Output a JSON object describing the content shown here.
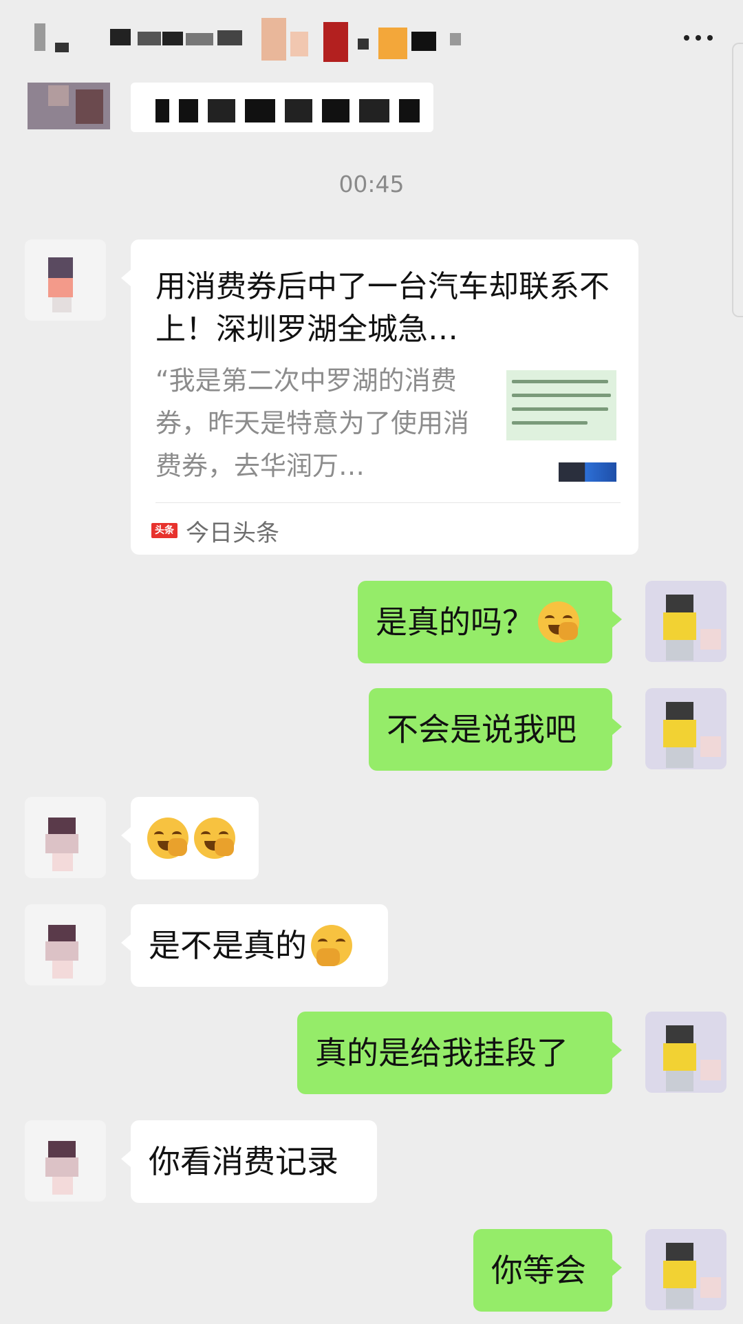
{
  "header": {
    "more_label": "•••"
  },
  "timestamp": "00:45",
  "link_card": {
    "title": "用消费券后中了一台汽车却联系不上！深圳罗湖全城急…",
    "description": "“我是第二次中罗湖的消费券，昨天是特意为了使用消费券，去华润万…",
    "source_logo": "头条",
    "source_name": "今日头条"
  },
  "messages": [
    {
      "side": "out",
      "text": "是真的吗？",
      "emoji": "rolling-laughing"
    },
    {
      "side": "out",
      "text": "不会是说我吧",
      "emoji": ""
    },
    {
      "side": "in",
      "text": "",
      "emoji": "rolling-laughing-x2"
    },
    {
      "side": "in",
      "text": "是不是真的",
      "emoji": "face-with-hand-over-mouth"
    },
    {
      "side": "out",
      "text": "真的是给我挂段了",
      "emoji": ""
    },
    {
      "side": "in",
      "text": "你看消费记录",
      "emoji": ""
    },
    {
      "side": "out",
      "text": "你等会",
      "emoji": ""
    }
  ],
  "colors": {
    "background": "#ededed",
    "outgoing_bubble": "#95ec69",
    "incoming_bubble": "#ffffff",
    "timestamp": "#8a8a8a"
  }
}
